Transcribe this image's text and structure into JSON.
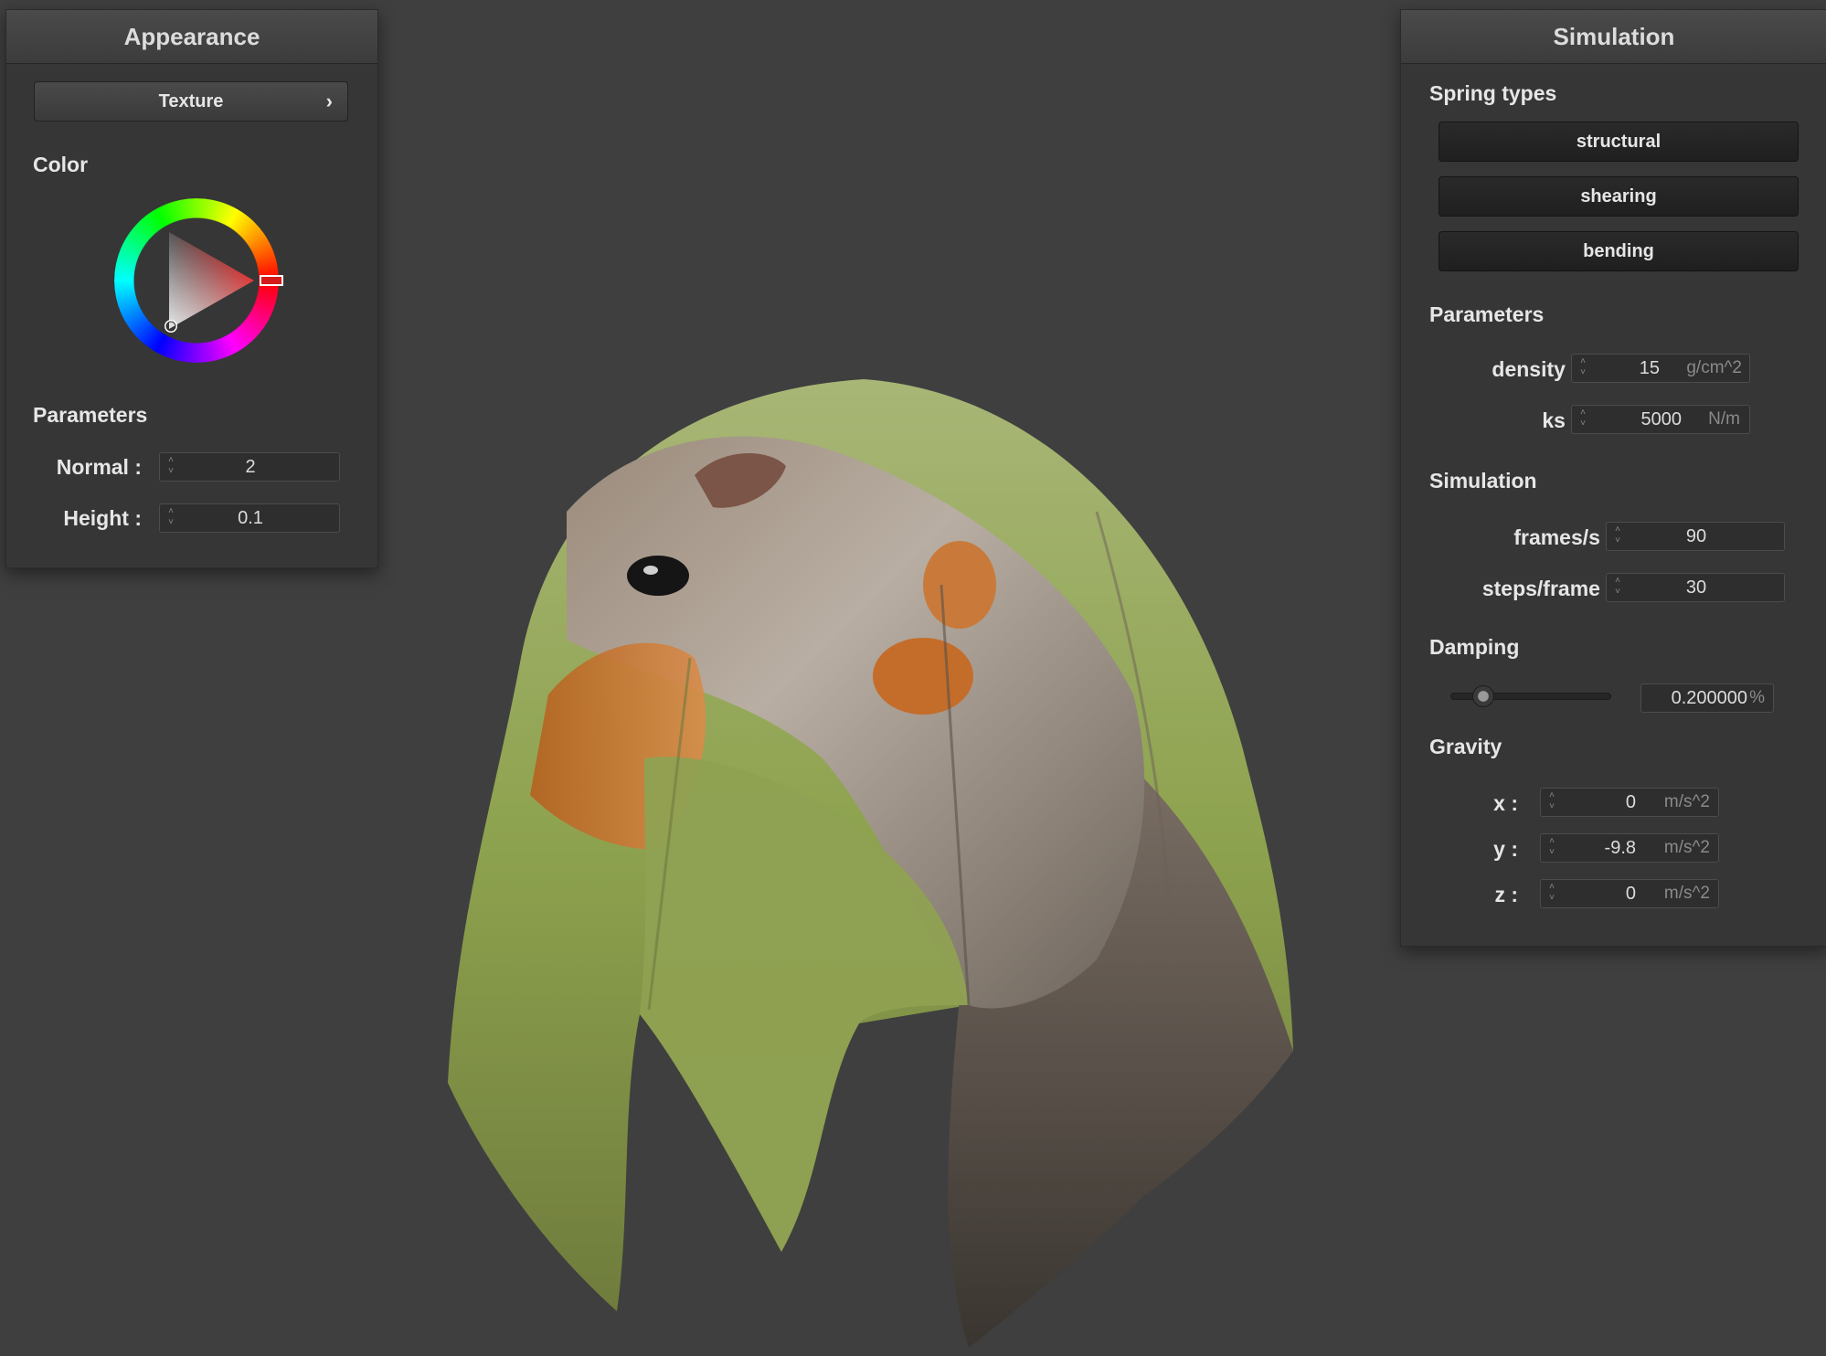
{
  "appearance": {
    "title": "Appearance",
    "texture_button": "Texture",
    "texture_chevron": "›",
    "color_label": "Color",
    "parameters_label": "Parameters",
    "normal_label": "Normal :",
    "normal_value": "2",
    "height_label": "Height :",
    "height_value": "0.1"
  },
  "simulation": {
    "title": "Simulation",
    "spring_types_label": "Spring types",
    "spring_types": [
      "structural",
      "shearing",
      "bending"
    ],
    "parameters_label": "Parameters",
    "density_label": "density :",
    "density_value": "15",
    "density_unit": "g/cm^2",
    "ks_label": "ks :",
    "ks_value": "5000",
    "ks_unit": "N/m",
    "simulation_label": "Simulation",
    "fps_label": "frames/s :",
    "fps_value": "90",
    "steps_label": "steps/frame :",
    "steps_value": "30",
    "damping_label": "Damping",
    "damping_value": "0.200000",
    "damping_unit": "%",
    "damping_slider_fraction": 0.2,
    "gravity_label": "Gravity",
    "gx_label": "x :",
    "gx_value": "0",
    "gy_label": "y :",
    "gy_value": "-9.8",
    "gz_label": "z :",
    "gz_value": "0",
    "gravity_unit": "m/s^2"
  },
  "colors": {
    "background": "#3f3f3f",
    "panel": "#363636",
    "selected_color": "#d31b1b"
  }
}
